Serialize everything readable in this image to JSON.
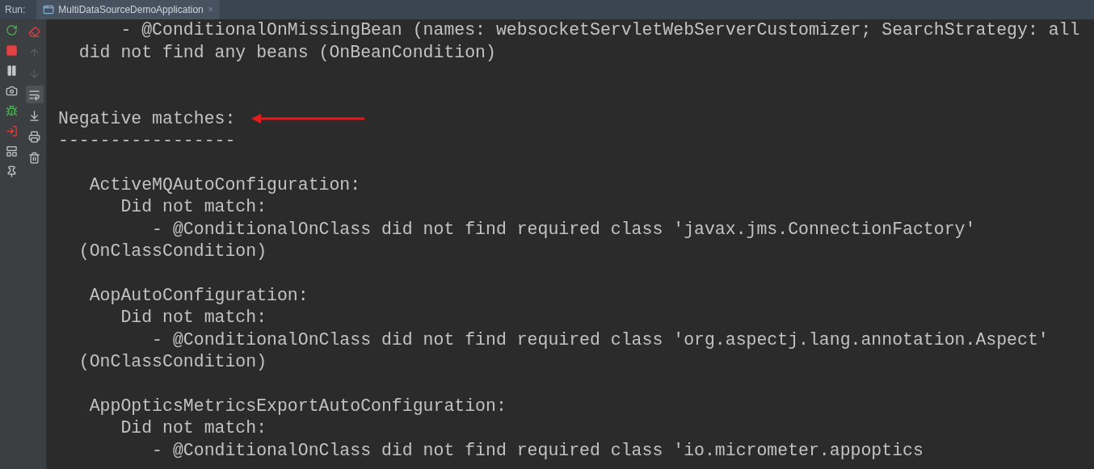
{
  "run_bar": {
    "label": "Run:",
    "tab": {
      "title": "MultiDataSourceDemoApplication",
      "close": "×",
      "selected": true
    }
  },
  "toolbar": {
    "left": [
      {
        "kind": "rerun"
      },
      {
        "kind": "stop"
      },
      {
        "kind": "pause"
      },
      {
        "kind": "camera"
      },
      {
        "kind": "debug"
      },
      {
        "kind": "exit"
      },
      {
        "kind": "layout"
      },
      {
        "kind": "pin"
      }
    ],
    "right": [
      {
        "kind": "clear",
        "disabled": false,
        "selected": false
      },
      {
        "kind": "up",
        "disabled": true,
        "selected": false
      },
      {
        "kind": "down",
        "disabled": true,
        "selected": false
      },
      {
        "kind": "wrap",
        "disabled": false,
        "selected": true
      },
      {
        "kind": "scroll-end",
        "disabled": false,
        "selected": false
      },
      {
        "kind": "print",
        "disabled": false,
        "selected": false
      },
      {
        "kind": "trash",
        "disabled": false,
        "selected": false
      }
    ]
  },
  "console": {
    "lines": [
      {
        "kind": "text",
        "text": "      - @ConditionalOnMissingBean (names: websocketServletWebServerCustomizer; SearchStrategy: all"
      },
      {
        "kind": "text",
        "text": "  did not find any beans (OnBeanCondition)"
      },
      {
        "kind": "blank"
      },
      {
        "kind": "blank"
      },
      {
        "kind": "text",
        "text": "Negative matches:",
        "arrow": true
      },
      {
        "kind": "text",
        "text": "-----------------"
      },
      {
        "kind": "blank"
      },
      {
        "kind": "text",
        "text": "   ActiveMQAutoConfiguration:"
      },
      {
        "kind": "text",
        "text": "      Did not match:"
      },
      {
        "kind": "text",
        "text": "         - @ConditionalOnClass did not find required class 'javax.jms.ConnectionFactory'"
      },
      {
        "kind": "text",
        "text": "  (OnClassCondition)"
      },
      {
        "kind": "blank"
      },
      {
        "kind": "text",
        "text": "   AopAutoConfiguration:"
      },
      {
        "kind": "text",
        "text": "      Did not match:"
      },
      {
        "kind": "text",
        "text": "         - @ConditionalOnClass did not find required class 'org.aspectj.lang.annotation.Aspect'"
      },
      {
        "kind": "text",
        "text": "  (OnClassCondition)"
      },
      {
        "kind": "blank"
      },
      {
        "kind": "text",
        "text": "   AppOpticsMetricsExportAutoConfiguration:"
      },
      {
        "kind": "text",
        "text": "      Did not match:"
      },
      {
        "kind": "text",
        "text": "         - @ConditionalOnClass did not find required class 'io.micrometer.appoptics"
      }
    ]
  }
}
